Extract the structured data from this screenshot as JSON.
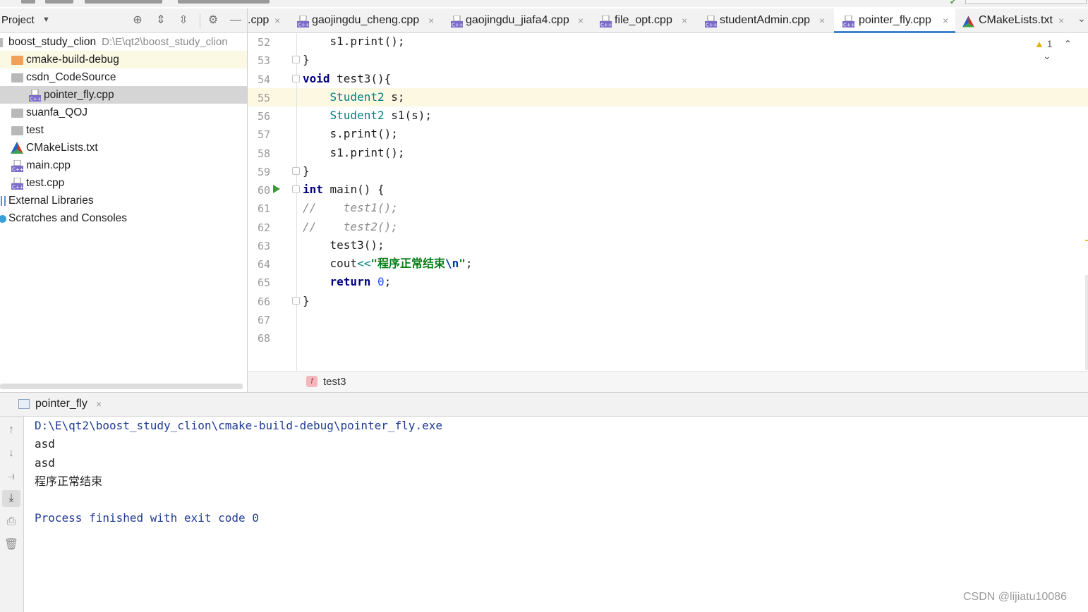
{
  "project_panel": {
    "title": "Project",
    "tree": [
      {
        "label": "boost_study_clion",
        "path": "D:\\E\\qt2\\boost_study_clion",
        "kind": "root"
      },
      {
        "label": "cmake-build-debug",
        "kind": "folder-orange"
      },
      {
        "label": "csdn_CodeSource",
        "kind": "folder"
      },
      {
        "label": "pointer_fly.cpp",
        "kind": "cpp"
      },
      {
        "label": "suanfa_QOJ",
        "kind": "folder"
      },
      {
        "label": "test",
        "kind": "folder"
      },
      {
        "label": "CMakeLists.txt",
        "kind": "cmake"
      },
      {
        "label": "main.cpp",
        "kind": "cpp"
      },
      {
        "label": "test.cpp",
        "kind": "cpp"
      },
      {
        "label": "External Libraries",
        "kind": "ext"
      },
      {
        "label": "Scratches and Consoles",
        "kind": "scratch"
      }
    ]
  },
  "tabs": [
    {
      "label": ".cpp",
      "close": "×"
    },
    {
      "label": "gaojingdu_cheng.cpp",
      "close": "×"
    },
    {
      "label": "gaojingdu_jiafa4.cpp",
      "close": "×"
    },
    {
      "label": "file_opt.cpp",
      "close": "×"
    },
    {
      "label": "studentAdmin.cpp",
      "close": "×"
    },
    {
      "label": "pointer_fly.cpp",
      "close": "×",
      "active": true
    },
    {
      "label": "CMakeLists.txt",
      "close": "×"
    }
  ],
  "editor": {
    "line_numbers": [
      "52",
      "53",
      "54",
      "55",
      "56",
      "57",
      "58",
      "59",
      "60",
      "61",
      "62",
      "63",
      "64",
      "65",
      "66",
      "67",
      "68"
    ],
    "inspection_count": "1",
    "current_function": "test3"
  },
  "code": {
    "l52": "s1.print();",
    "l53": "}",
    "l54_kw": "void",
    "l54_rest": " test3(){",
    "l55_type": "Student2",
    "l55_rest": " s;",
    "l56_type": "Student2",
    "l56_rest": " s1(s);",
    "l57": "s.print();",
    "l58": "s1.print();",
    "l59": "}",
    "l60_kw": "int",
    "l60_rest": " main() {",
    "l61": "//    test1();",
    "l62": "//    test2();",
    "l63": "test3();",
    "l64_a": "cout",
    "l64_op": "<<",
    "l64_str": "\"程序正常结束",
    "l64_esc": "\\n",
    "l64_end_q": "\"",
    "l64_semi": ";",
    "l65_kw": "return",
    "l65_num": "0",
    "l65_semi": ";",
    "l66": "}"
  },
  "run": {
    "tab_label": "pointer_fly",
    "output": [
      "D:\\E\\qt2\\boost_study_clion\\cmake-build-debug\\pointer_fly.exe",
      "asd",
      "asd",
      "程序正常结束",
      "",
      "Process finished with exit code 0"
    ]
  },
  "watermark": "CSDN @lijiatu10086",
  "colors": {
    "accent": "#4083c9",
    "keyword": "#000080",
    "type": "#008080",
    "string": "#067d17",
    "run_green": "#3c9a3c"
  }
}
